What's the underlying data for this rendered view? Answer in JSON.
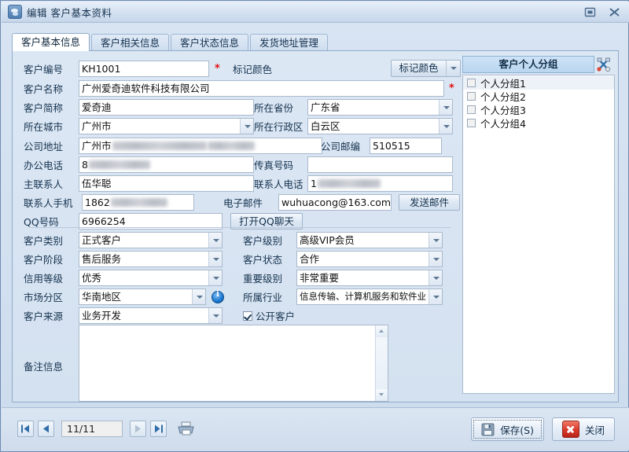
{
  "window": {
    "title": "编辑 客户基本资料",
    "icon": "customer-card-icon",
    "minimize_label": "—",
    "maximize_label": "□",
    "close_label": "✕"
  },
  "tabs": [
    {
      "label": "客户基本信息",
      "active": true
    },
    {
      "label": "客户相关信息",
      "active": false
    },
    {
      "label": "客户状态信息",
      "active": false
    },
    {
      "label": "发货地址管理",
      "active": false
    }
  ],
  "form": {
    "customer_no": {
      "label": "客户编号",
      "value": "KH1001",
      "required": "*"
    },
    "mark_color": {
      "label": "标记颜色",
      "button_label": "标记颜色"
    },
    "customer_name": {
      "label": "客户名称",
      "value": "广州爱奇迪软件科技有限公司",
      "required": "*"
    },
    "short_name": {
      "label": "客户简称",
      "value": "爱奇迪"
    },
    "province": {
      "label": "所在省份",
      "value": "广东省"
    },
    "city": {
      "label": "所在城市",
      "value": "广州市"
    },
    "district": {
      "label": "所在行政区",
      "value": "白云区"
    },
    "address": {
      "label": "公司地址",
      "value": "广州市"
    },
    "postcode": {
      "label": "公司邮编",
      "value": "510515"
    },
    "office_phone": {
      "label": "办公电话",
      "value": "8"
    },
    "fax": {
      "label": "传真号码",
      "value": ""
    },
    "main_contact": {
      "label": "主联系人",
      "value": "伍华聪"
    },
    "contact_phone": {
      "label": "联系人电话",
      "value": "1"
    },
    "contact_mobile": {
      "label": "联系人手机",
      "value": "1862"
    },
    "email": {
      "label": "电子邮件",
      "value": "wuhuacong@163.com"
    },
    "send_mail_button": "发送邮件",
    "qq": {
      "label": "QQ号码",
      "value": "6966254"
    },
    "open_qq_button": "打开QQ聊天",
    "category": {
      "label": "客户类别",
      "value": "正式客户"
    },
    "level": {
      "label": "客户级别",
      "value": "高级VIP会员"
    },
    "stage": {
      "label": "客户阶段",
      "value": "售后服务"
    },
    "status": {
      "label": "客户状态",
      "value": "合作"
    },
    "credit": {
      "label": "信用等级",
      "value": "优秀"
    },
    "importance": {
      "label": "重要级别",
      "value": "非常重要"
    },
    "market_area": {
      "label": "市场分区",
      "value": "华南地区",
      "info_icon": "info-icon"
    },
    "industry": {
      "label": "所属行业",
      "value": "信息传输、计算机服务和软件业"
    },
    "source": {
      "label": "客户来源",
      "value": "业务开发"
    },
    "public_customer": {
      "label": "公开客户",
      "checked": true
    },
    "remark": {
      "label": "备注信息",
      "value": "",
      "placeholder": ""
    }
  },
  "group_panel": {
    "title": "客户个人分组",
    "tool_icon": "tools-icon",
    "items": [
      {
        "label": "个人分组1",
        "checked": false,
        "selected": true
      },
      {
        "label": "个人分组2",
        "checked": false,
        "selected": false
      },
      {
        "label": "个人分组3",
        "checked": false,
        "selected": false
      },
      {
        "label": "个人分组4",
        "checked": false,
        "selected": false
      }
    ]
  },
  "bottom": {
    "first_page_icon": "first-page-icon",
    "prev_page_icon": "prev-page-icon",
    "page_value": "11/11",
    "next_page_icon": "next-page-icon",
    "last_page_icon": "last-page-icon",
    "print_icon": "printer-icon",
    "save_label": "保存(S)",
    "save_icon": "floppy-disk-icon",
    "close_label": "关闭",
    "close_icon": "red-cross-icon"
  },
  "colors": {
    "accent": "#b9d5ef",
    "required": "#e01010",
    "close_red": "#d8382a",
    "window_bg": "#d4e1f0"
  }
}
